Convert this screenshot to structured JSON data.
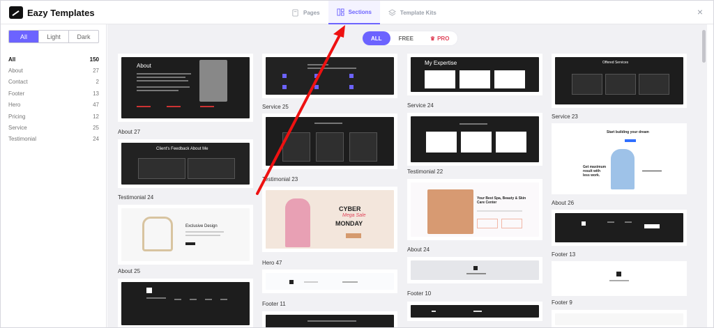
{
  "app": {
    "title": "Eazy Templates"
  },
  "tabs": [
    {
      "label": "Pages"
    },
    {
      "label": "Sections"
    },
    {
      "label": "Template Kits"
    }
  ],
  "sidebar": {
    "modes": [
      "All",
      "Light",
      "Dark"
    ],
    "categories": [
      {
        "name": "All",
        "count": "150"
      },
      {
        "name": "About",
        "count": "27"
      },
      {
        "name": "Contact",
        "count": "2"
      },
      {
        "name": "Footer",
        "count": "13"
      },
      {
        "name": "Hero",
        "count": "47"
      },
      {
        "name": "Pricing",
        "count": "12"
      },
      {
        "name": "Service",
        "count": "25"
      },
      {
        "name": "Testimonial",
        "count": "24"
      }
    ]
  },
  "filter": {
    "all": "ALL",
    "free": "FREE",
    "pro": "PRO"
  },
  "cards": {
    "about27": "About 27",
    "testimonial24": "Testimonial 24",
    "about25": "About 25",
    "service25": "Service 25",
    "testimonial23": "Testimonial 23",
    "hero47": "Hero 47",
    "footer11": "Footer 11",
    "service24": "Service 24",
    "testimonial22": "Testimonial 22",
    "about24": "About 24",
    "footer10": "Footer 10",
    "service23": "Service 23",
    "about26": "About 26",
    "footer13": "Footer 13",
    "footer9": "Footer 9"
  },
  "previews": {
    "about": "About",
    "feedback": "Client's Feedback About Me",
    "exclusive": "Exclusive Design",
    "myexp": "My Expertise",
    "cyber1": "CYBER",
    "cyber2": "Mega Sale",
    "cyber3": "MONDAY",
    "spa": "Your Best Spa, Beauty & Skin Care Center",
    "offered": "Offered Services",
    "start": "Start building your dream",
    "growth": "Get maximum result with less work."
  },
  "colors": {
    "accent": "#6c63ff",
    "pro": "#e0445a",
    "arrow": "#e11"
  }
}
